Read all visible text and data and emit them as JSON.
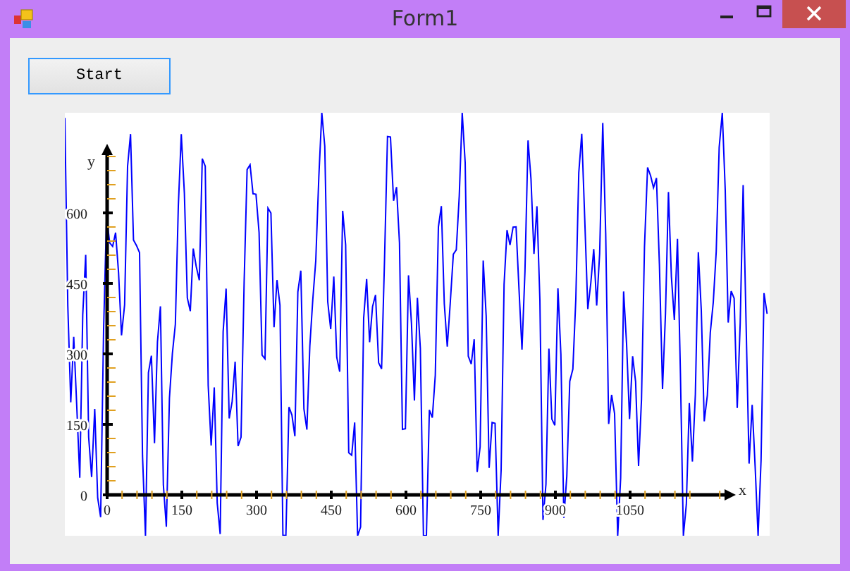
{
  "window": {
    "title": "Form1"
  },
  "start_button": {
    "label": "Start"
  },
  "chart": {
    "x_axis_label": "x",
    "y_axis_label": "y",
    "x_tick_labels": [
      "0",
      "150",
      "300",
      "450",
      "600",
      "750",
      "900",
      "1050"
    ],
    "y_tick_labels": [
      "600",
      "450",
      "300",
      "150",
      "0"
    ]
  }
}
